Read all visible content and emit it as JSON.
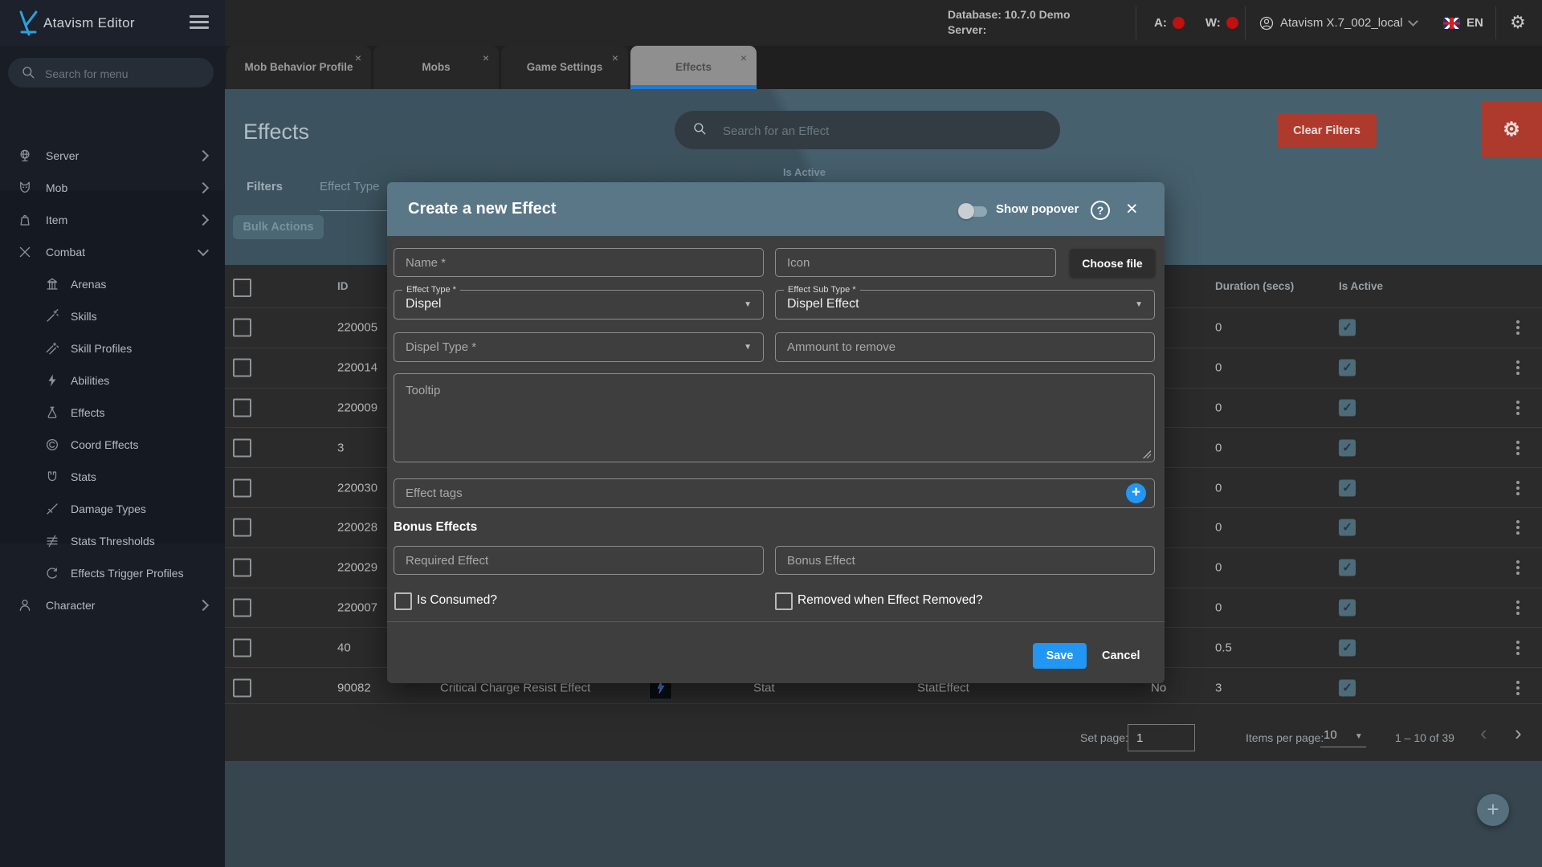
{
  "colors": {
    "accent_blue": "#2196f3",
    "danger_red": "#ad3a2c",
    "modal_header_blue": "#597787",
    "check_teal": "#4d6b79",
    "tab_underline": "#1c7cd4",
    "status_dot_red": "#c01010"
  },
  "icons": {
    "close": "×",
    "dropdown": "▼",
    "gear": "⚙",
    "check": "✓",
    "plus": "+",
    "help": "?",
    "chev_left": "‹",
    "chev_right": "›"
  },
  "topbar": {
    "app_title": "Atavism Editor",
    "database_line1": "Database: 10.7.0 Demo",
    "database_line2": "Server:",
    "a_label": "A:",
    "w_label": "W:",
    "account_name": "Atavism X.7_002_local",
    "language": "EN"
  },
  "sidebar": {
    "search_placeholder": "Search for menu",
    "top_items": [
      {
        "label": "Server"
      },
      {
        "label": "Mob"
      },
      {
        "label": "Item"
      }
    ],
    "combat": {
      "label": "Combat"
    },
    "combat_children": [
      {
        "label": "Arenas"
      },
      {
        "label": "Skills"
      },
      {
        "label": "Skill Profiles"
      },
      {
        "label": "Abilities"
      },
      {
        "label": "Effects"
      },
      {
        "label": "Coord Effects"
      },
      {
        "label": "Stats"
      },
      {
        "label": "Damage Types"
      },
      {
        "label": "Stats Thresholds"
      },
      {
        "label": "Effects Trigger Profiles"
      }
    ],
    "character": {
      "label": "Character"
    }
  },
  "tabs": [
    {
      "label": "Mob Behavior Profile"
    },
    {
      "label": "Mobs"
    },
    {
      "label": "Game Settings"
    },
    {
      "label": "Effects",
      "active": true
    }
  ],
  "page": {
    "title": "Effects",
    "search_placeholder": "Search for an Effect",
    "clear_filters_label": "Clear Filters",
    "filters_label": "Filters",
    "effect_type_filter_label": "Effect Type",
    "is_active_filter_label": "Is Active",
    "bulk_actions_label": "Bulk Actions"
  },
  "table": {
    "headers": {
      "id": "ID",
      "duration": "Duration (secs)",
      "is_active": "Is Active"
    },
    "rows": [
      {
        "id": "220005",
        "duration": "0",
        "active": true
      },
      {
        "id": "220014",
        "duration": "0",
        "active": true
      },
      {
        "id": "220009",
        "duration": "0",
        "active": true
      },
      {
        "id": "3",
        "duration": "0",
        "active": true
      },
      {
        "id": "220030",
        "duration": "0",
        "active": true
      },
      {
        "id": "220028",
        "duration": "0",
        "active": true
      },
      {
        "id": "220029",
        "duration": "0",
        "active": true
      },
      {
        "id": "220007",
        "duration": "0",
        "active": true
      },
      {
        "id": "40",
        "duration": "0.5",
        "active": true
      },
      {
        "id": "90082",
        "duration": "3",
        "active": true,
        "name": "Critical Charge Resist Effect",
        "effect_type": "Stat",
        "effect_sub_type": "StatEffect",
        "extra": "No",
        "has_icon": true
      }
    ],
    "pagination": {
      "set_page_label": "Set page:",
      "set_page_value": "1",
      "items_per_page_label": "Items per page:",
      "items_per_page_value": "10",
      "range_label": "1 – 10 of 39"
    }
  },
  "modal": {
    "title": "Create a new Effect",
    "show_popover_label": "Show popover",
    "fields": {
      "name_placeholder": "Name *",
      "icon_placeholder": "Icon",
      "choose_file_label": "Choose file",
      "effect_type_label": "Effect Type *",
      "effect_type_value": "Dispel",
      "effect_sub_type_label": "Effect Sub Type *",
      "effect_sub_type_value": "Dispel Effect",
      "dispel_type_placeholder": "Dispel Type *",
      "amount_placeholder": "Ammount to remove",
      "tooltip_placeholder": "Tooltip",
      "effect_tags_placeholder": "Effect tags",
      "required_effect_placeholder": "Required Effect",
      "bonus_effect_placeholder": "Bonus Effect"
    },
    "bonus_heading": "Bonus Effects",
    "is_consumed_label": "Is Consumed?",
    "removed_label": "Removed when Effect Removed?",
    "save_label": "Save",
    "cancel_label": "Cancel"
  }
}
